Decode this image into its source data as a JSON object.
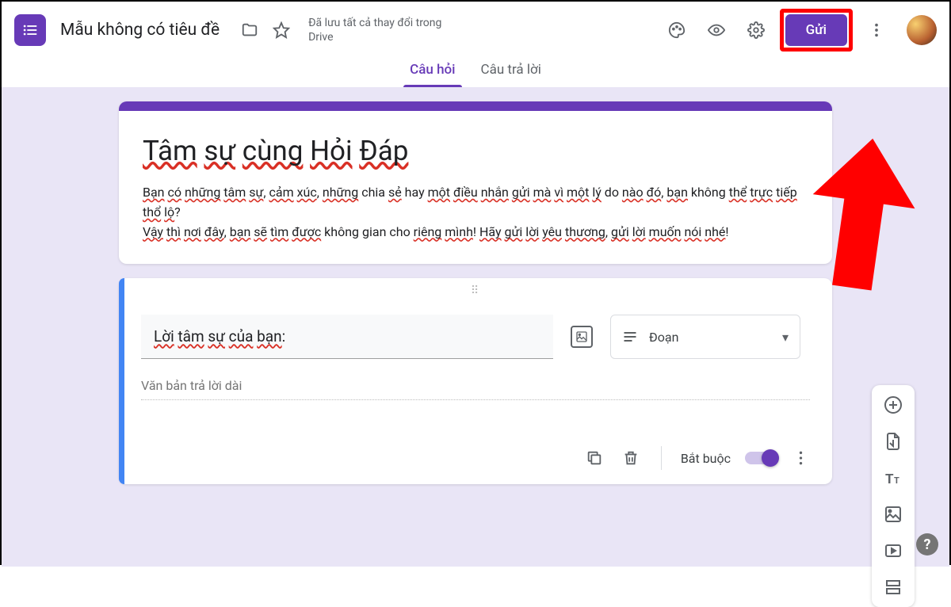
{
  "header": {
    "doc_title": "Mẫu không có tiêu đề",
    "save_status": "Đã lưu tất cả thay đổi trong Drive",
    "send_label": "Gửi"
  },
  "tabs": {
    "questions": "Câu hỏi",
    "responses": "Câu trả lời"
  },
  "title_card": {
    "title_html": "<span class='spell'>Tâm</span> <span class='spell'>sự</span> <span class='spell'>cùng</span> <span class='spell'>Hỏi</span> <span class='spell'>Đáp</span>",
    "desc_html": "<span class='spell'>Bạn</span> <span class='spell'>có</span> <span class='spell'>những</span> <span class='spell'>tâm</span> <span class='spell'>sự</span>, <span class='spell'>cảm</span> <span class='spell'>xúc</span>, <span class='spell'>những</span> chia <span class='spell'>sẻ</span> hay <span class='spell'>một</span> <span class='spell'>điều</span> <span class='spell'>nhắn</span> <span class='spell'>gửi</span> <span class='spell'>mà</span> <span class='spell'>vì</span> <span class='spell'>một</span> <span class='spell'>lý</span> do <span class='spell'>nào</span> <span class='spell'>đó</span>, <span class='spell'>bạn</span> không <span class='spell'>thể</span> <span class='spell'>trực</span> <span class='spell'>tiếp</span> <span class='spell'>thổ</span> <span class='spell'>lộ</span>?<br><span class='spell'>Vậy</span> <span class='spell'>thì</span> <span class='spell'>nơi</span> <span class='spell'>đây</span>, <span class='spell'>bạn</span> <span class='spell'>sẽ</span> <span class='spell'>tìm</span> <span class='spell'>được</span> không gian cho <span class='spell'>riêng</span> <span class='spell'>mình</span>! <span class='spell'>Hãy</span> <span class='spell'>gửi</span> <span class='spell'>lời</span> <span class='spell'>yêu</span> <span class='spell'>thương</span>, <span class='spell'>gửi</span> <span class='spell'>lời</span> <span class='spell'>muốn</span> <span class='spell'>nói</span> <span class='spell'>nhé</span>!"
  },
  "question": {
    "title_html": "<span class='spell'>Lời</span> <span class='spell'>tâm</span> <span class='spell'>sự</span> <span class='spell'>của</span> <span class='spell'>bạn</span>:",
    "type_label": "Đoạn",
    "answer_placeholder": "Văn bản trả lời dài",
    "required_label": "Bắt buộc"
  },
  "colors": {
    "accent": "#673ab7",
    "highlight": "#ff0000"
  }
}
